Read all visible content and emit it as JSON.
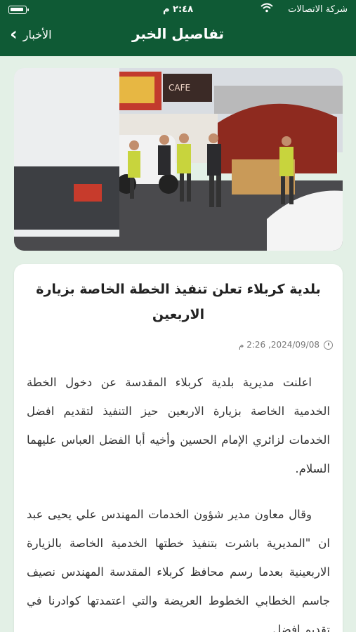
{
  "status_bar": {
    "carrier": "شركة الاتصالات",
    "time": "٢:٤٨ م"
  },
  "header": {
    "title": "تفاصيل الخبر",
    "back_label": "الأخبار"
  },
  "article": {
    "title": "بلدية كربلاء تعلن تنفيذ الخطة الخاصة بزيارة الاربعين",
    "date": "2024/09/08, 2:26 م",
    "paragraphs": [
      "اعلنت مديرية بلدية كربلاء المقدسة عن دخول الخطة الخدمية الخاصة بزيارة الاربعين حيز التنفيذ لتقديم افضل الخدمات لزائري الإمام الحسين وأخيه أبا الفضل العباس عليهما السلام.",
      "وقال معاون مدير شؤون الخدمات المهندس علي يحيى عبد ان \"المديرية باشرت بتنفيذ خطتها الخدمية الخاصة بالزيارة الاربعينية بعدما رسم محافظ كربلاء المقدسة المهندس نصيف جاسم الخطابي الخطوط العريضة والتي اعتمدتها كوادرنا في تقديم افضل"
    ]
  },
  "image_signs": {
    "cafe": "CAFE"
  },
  "colors": {
    "header_bg": "#0f5a35",
    "page_bg": "#e3f0e6"
  }
}
